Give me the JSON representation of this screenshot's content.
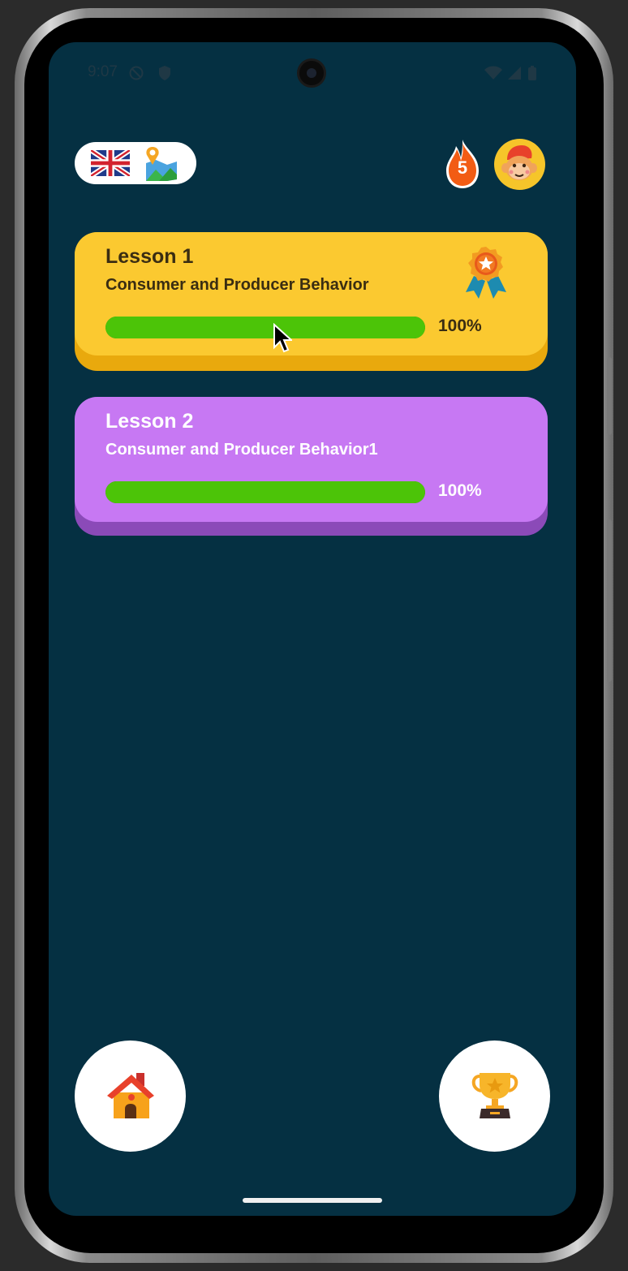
{
  "status_bar": {
    "time": "9:07"
  },
  "top_bar": {
    "language": "uk-flag-icon",
    "map": "map-pin-icon",
    "streak_count": "5",
    "avatar": "monkey-avatar-icon"
  },
  "lessons": [
    {
      "title": "Lesson 1",
      "subtitle": "Consumer and Producer Behavior",
      "progress": 100,
      "progress_label": "100%",
      "color": "#fbc930",
      "has_medal": true
    },
    {
      "title": "Lesson 2",
      "subtitle": "Consumer and Producer Behavior1",
      "progress": 100,
      "progress_label": "100%",
      "color": "#c778f3",
      "has_medal": false
    }
  ],
  "bottom_nav": {
    "home": "home-icon",
    "leaderboard": "trophy-icon"
  },
  "colors": {
    "background": "#053042",
    "progress_fill": "#4cc408",
    "streak": "#f25c14"
  }
}
